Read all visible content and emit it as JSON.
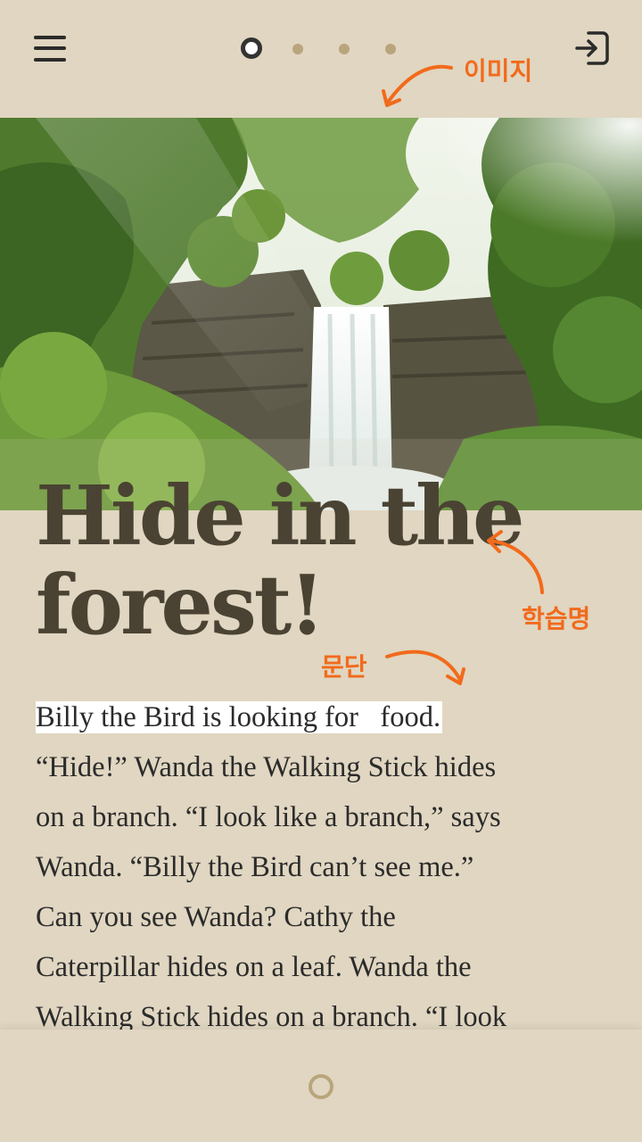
{
  "header": {
    "page_indicator": {
      "total": 4,
      "current": 1
    }
  },
  "annotations": {
    "image": "이미지",
    "title": "학습명",
    "paragraph": "문단"
  },
  "story": {
    "title_line1": "Hide in the",
    "title_line2": "forest!",
    "highlight": "Billy the Bird is looking for   food.",
    "lines": [
      "“Hide!” Wanda the Walking Stick hides",
      "on a branch. “I look like a branch,” says",
      "Wanda. “Billy the Bird can’t see me.”",
      "Can you see Wanda? Cathy the",
      "Caterpillar hides on a leaf. Wanda the",
      "Walking Stick hides on a branch. “I look"
    ]
  },
  "colors": {
    "background": "#e0d6c1",
    "accent": "#f26a1b",
    "title": "#4a4333",
    "dot_inactive": "#b9a57c"
  }
}
